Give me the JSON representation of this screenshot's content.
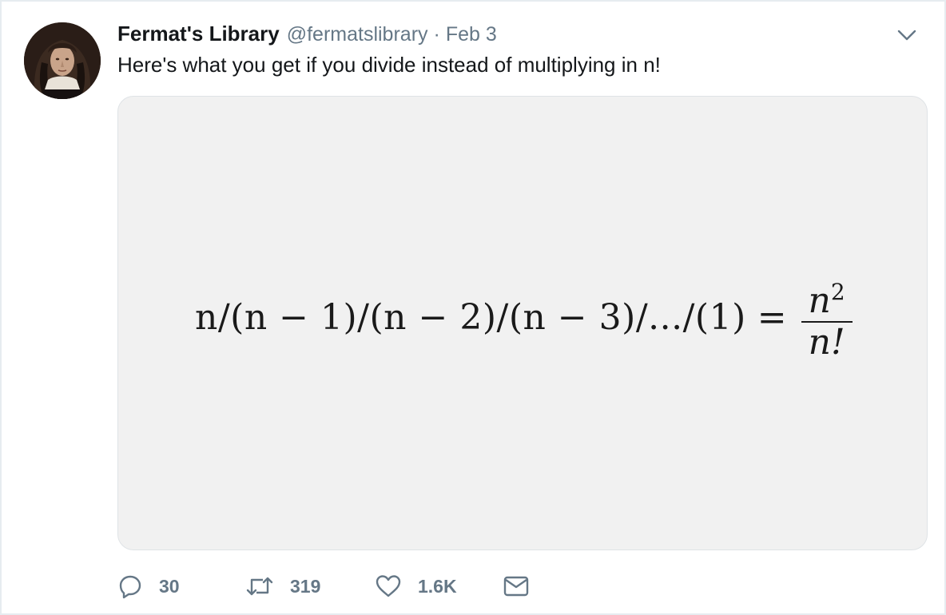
{
  "tweet": {
    "display_name": "Fermat's Library",
    "handle": "@fermatslibrary",
    "separator": "·",
    "date": "Feb 3",
    "text": "Here's what you get if you divide instead of multiplying in n!"
  },
  "media": {
    "formula_lhs": "n/(n − 1)/(n − 2)/(n − 3)/.../(1)",
    "formula_eq": "=",
    "formula_numerator": "n",
    "formula_numerator_exp": "2",
    "formula_denominator": "n!"
  },
  "actions": {
    "reply_count": "30",
    "retweet_count": "319",
    "like_count": "1.6K"
  },
  "icons": {
    "caret": "chevron-down-icon",
    "reply": "reply-icon",
    "retweet": "retweet-icon",
    "like": "heart-icon",
    "dm": "envelope-icon"
  },
  "colors": {
    "secondary_text": "#657786",
    "media_background": "#f1f1f1",
    "border": "#e6ecf0"
  }
}
